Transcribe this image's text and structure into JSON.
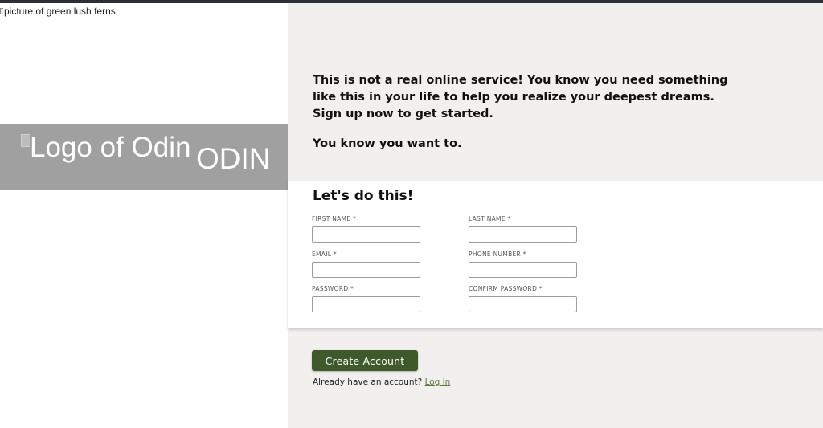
{
  "hero_image": {
    "alt": "picture of green lush ferns"
  },
  "logo": {
    "alt": "Logo of Odin",
    "title": "ODIN"
  },
  "intro": {
    "text": "This is not a real online service! You know you need something like this in your life to help you realize your deepest dreams. Sign up now to get started.",
    "tagline": "You know you want to."
  },
  "form": {
    "heading": "Let's do this!",
    "fields": [
      {
        "label": "FIRST NAME *",
        "value": ""
      },
      {
        "label": "LAST NAME *",
        "value": ""
      },
      {
        "label": "EMAIL *",
        "value": ""
      },
      {
        "label": "PHONE NUMBER *",
        "value": ""
      },
      {
        "label": "PASSWORD *",
        "value": ""
      },
      {
        "label": "CONFIRM PASSWORD *",
        "value": ""
      }
    ]
  },
  "actions": {
    "create_label": "Create Account",
    "login_prompt": "Already have an account?",
    "login_link": "Log in"
  },
  "colors": {
    "topbar": "#2b2f36",
    "logo_banner": "#a0a0a0",
    "right_bg": "#f2f0ee",
    "button": "#3f5a2a",
    "link": "#5a7a3a"
  }
}
